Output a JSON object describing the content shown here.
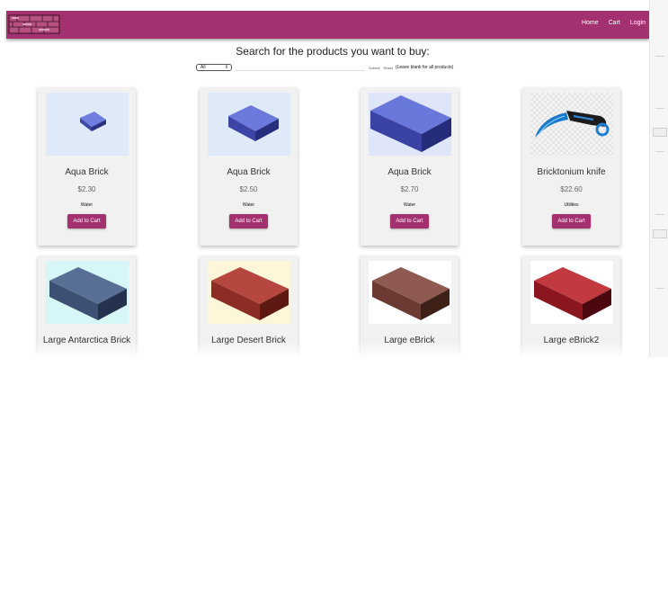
{
  "nav": {
    "logo_icon": "brick-store-logo-icon",
    "links": [
      "Home",
      "Cart",
      "Login"
    ]
  },
  "search": {
    "heading": "Search for the products you want to buy:",
    "category_selected": "All",
    "query_value": "",
    "submit_label": "Submit",
    "reset_label": "Reset",
    "note": "(Leave blank for all products)"
  },
  "colors": {
    "brand": "#a3306f"
  },
  "products": [
    {
      "name": "Aqua Brick",
      "price": "$2.30",
      "category": "Water",
      "button": "Add to Cart",
      "image_icon": "small-blue-brick-icon",
      "image_bg": "#dfeaf8"
    },
    {
      "name": "Aqua Brick",
      "price": "$2.50",
      "category": "Water",
      "button": "Add to Cart",
      "image_icon": "medium-blue-brick-icon",
      "image_bg": "#dfeaf8"
    },
    {
      "name": "Aqua Brick",
      "price": "$2.70",
      "category": "Water",
      "button": "Add to Cart",
      "image_icon": "large-blue-brick-icon",
      "image_bg": "#dfeaf8"
    },
    {
      "name": "Bricktonium knife",
      "price": "$22.60",
      "category": "Utilities",
      "button": "Add to Cart",
      "image_icon": "karambit-knife-icon",
      "image_bg": "#f3f3f3"
    },
    {
      "name": "Large Antarctica Brick",
      "price": "",
      "category": "",
      "button": "",
      "image_icon": "grey-blue-brick-icon",
      "image_bg": "#d6f6f7"
    },
    {
      "name": "Large Desert Brick",
      "price": "",
      "category": "",
      "button": "",
      "image_icon": "red-desert-brick-icon",
      "image_bg": "#fdf6d8"
    },
    {
      "name": "Large eBrick",
      "price": "",
      "category": "",
      "button": "",
      "image_icon": "brown-brick-icon",
      "image_bg": "#ffffff"
    },
    {
      "name": "Large eBrick2",
      "price": "",
      "category": "",
      "button": "",
      "image_icon": "dark-red-brick-icon",
      "image_bg": "#ffffff"
    }
  ]
}
